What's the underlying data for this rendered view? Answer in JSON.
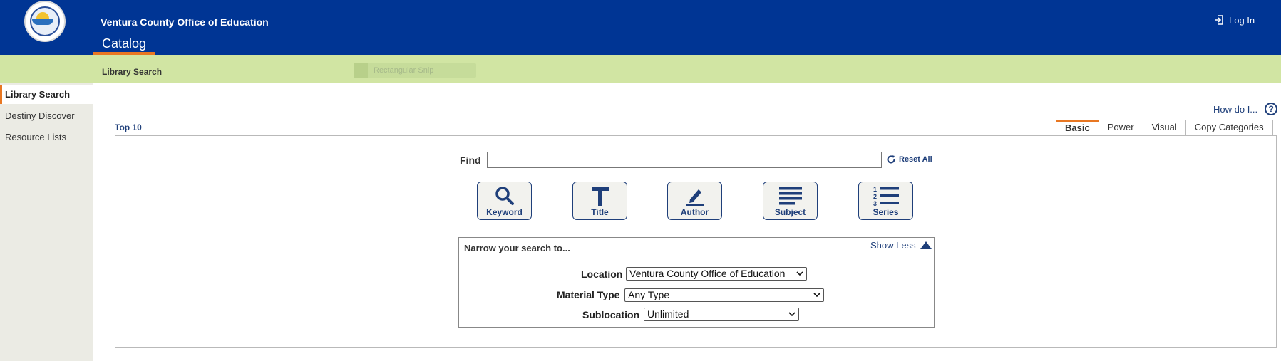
{
  "header": {
    "site_title": "Ventura County Office of Education",
    "catalog_tab": "Catalog",
    "login_label": "Log In",
    "brand_color": "#003594",
    "accent_color": "#e87722"
  },
  "subheader": {
    "label": "Library Search",
    "ghost_overlay": "Rectangular Snip"
  },
  "sidebar": {
    "items": [
      {
        "label": "Library Search",
        "active": true
      },
      {
        "label": "Destiny Discover",
        "active": false
      },
      {
        "label": "Resource Lists",
        "active": false
      }
    ]
  },
  "main": {
    "how_do_i": "How do I...",
    "top10": "Top 10",
    "tabs": [
      {
        "label": "Basic",
        "active": true
      },
      {
        "label": "Power",
        "active": false
      },
      {
        "label": "Visual",
        "active": false
      },
      {
        "label": "Copy Categories",
        "active": false
      }
    ],
    "find_label": "Find",
    "find_value": "",
    "reset_label": "Reset All",
    "search_buttons": [
      {
        "label": "Keyword",
        "icon": "search-icon"
      },
      {
        "label": "Title",
        "icon": "title-t-icon"
      },
      {
        "label": "Author",
        "icon": "pen-icon"
      },
      {
        "label": "Subject",
        "icon": "lines-icon"
      },
      {
        "label": "Series",
        "icon": "numbered-list-icon"
      }
    ],
    "narrow": {
      "title": "Narrow your search to...",
      "toggle_label": "Show Less",
      "location_label": "Location",
      "location_value": "Ventura County Office of Education",
      "material_label": "Material Type",
      "material_value": "Any Type",
      "sublocation_label": "Sublocation",
      "sublocation_value": "Unlimited"
    }
  }
}
